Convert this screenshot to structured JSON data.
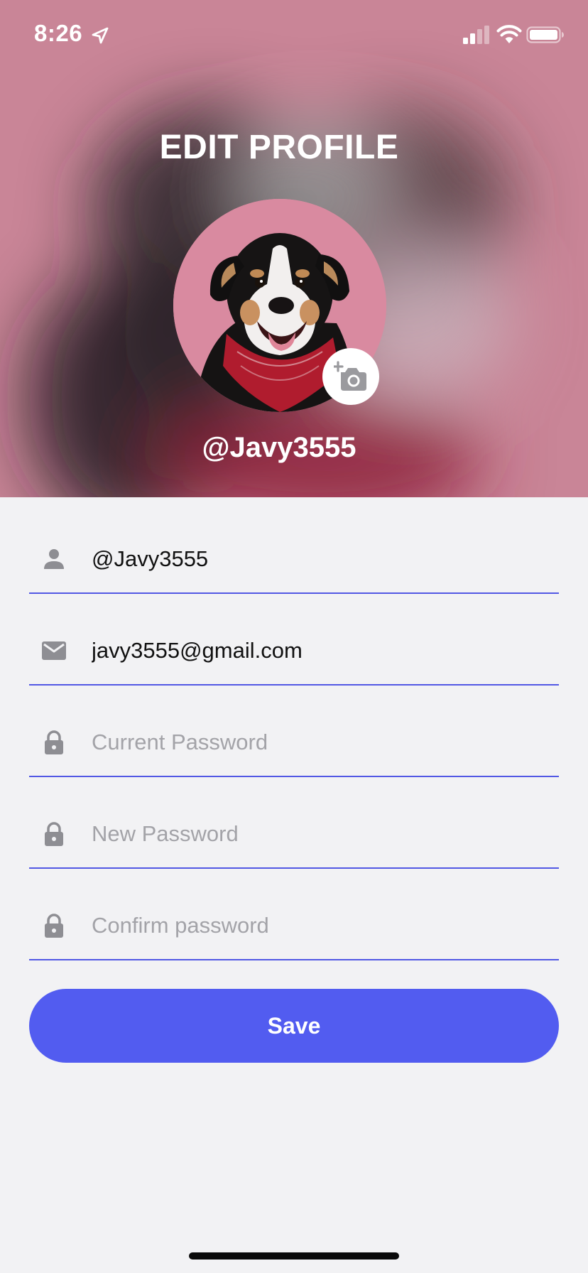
{
  "status_bar": {
    "time": "8:26"
  },
  "header": {
    "title": "EDIT PROFILE",
    "username": "@Javy3555"
  },
  "form": {
    "username": {
      "value": "@Javy3555",
      "placeholder": ""
    },
    "email": {
      "value": "javy3555@gmail.com",
      "placeholder": ""
    },
    "current_password": {
      "value": "",
      "placeholder": "Current Password"
    },
    "new_password": {
      "value": "",
      "placeholder": "New Password"
    },
    "confirm_password": {
      "value": "",
      "placeholder": "Confirm password"
    }
  },
  "save_label": "Save",
  "icons": {
    "status": [
      "location-arrow-icon",
      "cellular-signal-icon",
      "wifi-icon",
      "battery-icon"
    ],
    "fields": [
      "person-icon",
      "mail-icon",
      "lock-icon",
      "lock-icon",
      "lock-icon"
    ],
    "avatar_badge": "add-photo-camera-icon"
  },
  "colors": {
    "header_bg": "#c98597",
    "accent": "#525cf0",
    "underline": "#5258e4",
    "page_bg": "#f2f2f4",
    "icon_gray": "#8e8e93",
    "placeholder": "#a3a3a8"
  }
}
